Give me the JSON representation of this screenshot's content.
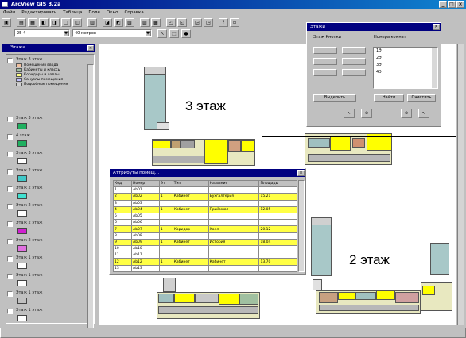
{
  "window": {
    "title": "ArcView GIS 3.2a"
  },
  "menu": [
    "Файл",
    "Редактировать",
    "Таблица",
    "Поле",
    "Окно",
    "Справка"
  ],
  "toolbar2": {
    "field1": "25 4",
    "field2": "40 метров"
  },
  "layers_panel": {
    "title": "Этажи",
    "legend_title": "Этаж 3 этаж",
    "legend": [
      {
        "label": "Помещения ввода",
        "color": "#f0c0a0"
      },
      {
        "label": "Кабинеты и классы",
        "color": "#a0c0a0"
      },
      {
        "label": "Коридоры и холлы",
        "color": "#ffff80"
      },
      {
        "label": "Санузлы помещения",
        "color": "#c0c0ff"
      },
      {
        "label": "Подсобные помещения",
        "color": "#d0d0d0"
      }
    ],
    "layers": [
      {
        "label": "Этаж 3 этаж",
        "color": "#20b060"
      },
      {
        "label": "4 этаж",
        "color": "#20b060"
      },
      {
        "label": "Этаж 3 этаж",
        "color": "#ffffff"
      },
      {
        "label": "Этаж 2 этаж",
        "color": "#40c8c8"
      },
      {
        "label": "Этаж 2 этаж",
        "color": "#40e0d0"
      },
      {
        "label": "Этаж 2 этаж",
        "color": "#ffffff"
      },
      {
        "label": "Этаж 2 этаж",
        "color": "#d020d0"
      },
      {
        "label": "Этаж 2 этаж",
        "color": "#e070e0"
      },
      {
        "label": "Этаж 1 этаж",
        "color": "#ffffff"
      },
      {
        "label": "Этаж 1 этаж",
        "color": "#ffffff"
      },
      {
        "label": "Этаж 1 этаж",
        "color": "#c0c0c0"
      },
      {
        "label": "Этаж 1 этаж",
        "color": "#ffffff"
      }
    ]
  },
  "canvas": {
    "label_top": "3 этаж",
    "label_bottom": "2 этаж"
  },
  "floors_panel": {
    "title": "Этажи",
    "col1": "Этаж Кнопки",
    "col2": "Номера комнат",
    "items": [
      "1Э",
      "2Э",
      "3Э",
      "4Э"
    ],
    "btn_left": "Выделить",
    "btn_mid": "Найти",
    "btn_right": "Очистить"
  },
  "table": {
    "title": "Аттрибуты помещ...",
    "columns": [
      "Код",
      "Номер",
      "Эт",
      "Тип",
      "Название",
      "Площадь"
    ],
    "rows": [
      [
        "1",
        "Ab01",
        "",
        "",
        "",
        ""
      ],
      [
        "2",
        "Ab02",
        "1",
        "Кабинет",
        "Бухгалтерия",
        "15.21"
      ],
      [
        "3",
        "Ab03",
        "",
        "",
        "",
        ""
      ],
      [
        "4",
        "Ab04",
        "1",
        "Кабинет",
        "Приёмная",
        "12.05"
      ],
      [
        "5",
        "Ab05",
        "",
        "",
        "",
        ""
      ],
      [
        "6",
        "Ab06",
        "",
        "",
        "",
        ""
      ],
      [
        "7",
        "Ab07",
        "1",
        "Коридор",
        "Холл",
        "20.12"
      ],
      [
        "8",
        "Ab08",
        "",
        "",
        "",
        ""
      ],
      [
        "9",
        "Ab09",
        "1",
        "Кабинет",
        "История",
        "18.04"
      ],
      [
        "10",
        "Ab10",
        "",
        "",
        "",
        ""
      ],
      [
        "11",
        "Ab11",
        "",
        "",
        "",
        ""
      ],
      [
        "12",
        "Ab12",
        "1",
        "Кабинет",
        "Кабинет",
        "13.70"
      ],
      [
        "13",
        "Ab13",
        "",
        "",
        "",
        ""
      ]
    ]
  }
}
